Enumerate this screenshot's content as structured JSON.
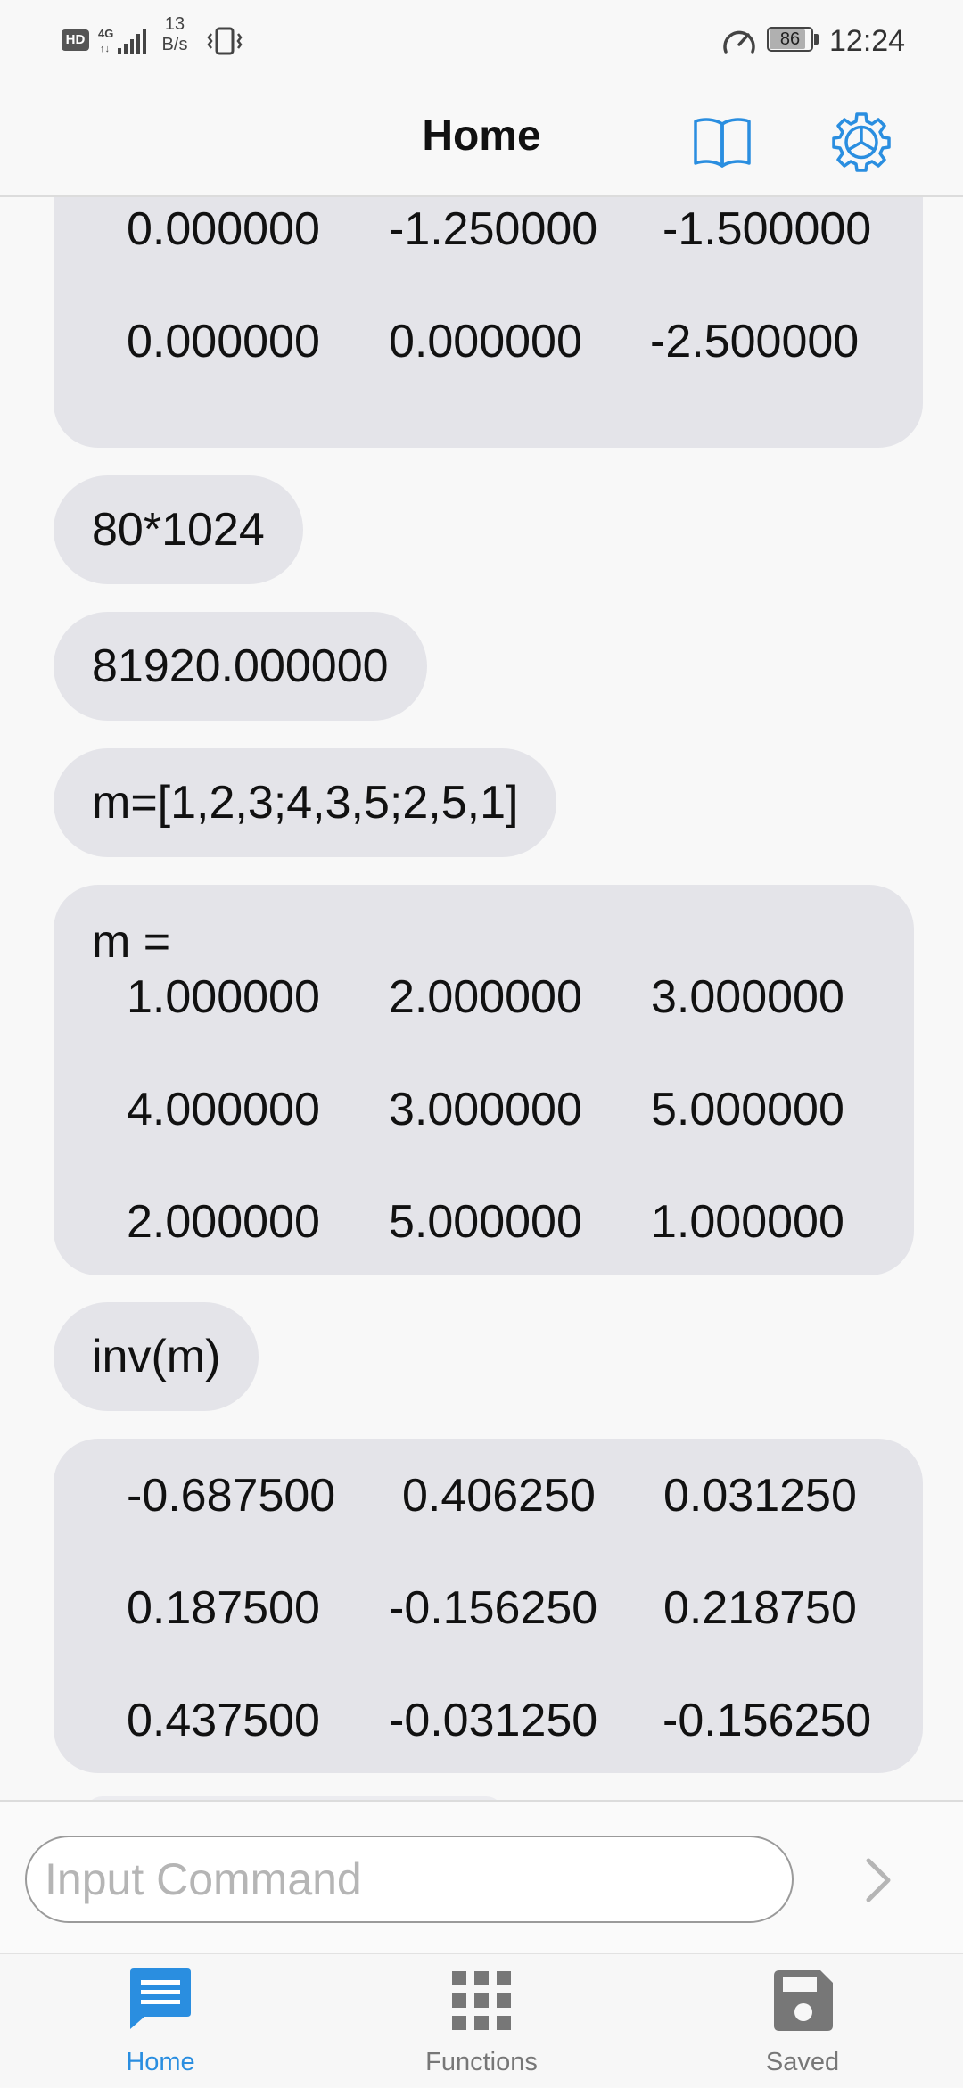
{
  "status_bar": {
    "hd": "HD",
    "network": "4G",
    "speed_value": "13",
    "speed_unit": "B/s",
    "battery": "86",
    "battery_level": 0.86,
    "time": "12:24"
  },
  "header": {
    "title": "Home",
    "icons": [
      "book-icon",
      "gear-icon"
    ]
  },
  "history": {
    "partial_matrix": {
      "rows": [
        [
          "0.000000",
          "-1.250000",
          "-1.500000"
        ],
        [
          "0.000000",
          "0.000000",
          "-2.500000"
        ]
      ]
    },
    "entries": [
      {
        "text": "80*1024"
      },
      {
        "text": "81920.000000"
      },
      {
        "text": "m=[1,2,3;4,3,5;2,5,1]"
      }
    ],
    "matrix_m": {
      "label": "m =",
      "rows": [
        [
          "1.000000",
          "2.000000",
          "3.000000"
        ],
        [
          "4.000000",
          "3.000000",
          "5.000000"
        ],
        [
          "2.000000",
          "5.000000",
          "1.000000"
        ]
      ]
    },
    "inv_command": "inv(m)",
    "inv_result": {
      "rows": [
        [
          "-0.687500",
          "0.406250",
          "0.031250"
        ],
        [
          "0.187500",
          "-0.156250",
          "0.218750"
        ],
        [
          "0.437500",
          "-0.031250",
          "-0.156250"
        ]
      ]
    }
  },
  "input": {
    "value": "",
    "placeholder": "Input Command"
  },
  "nav": {
    "accent_color": "#2a8ee0",
    "inactive_color": "#777777",
    "items": [
      {
        "label": "Home",
        "icon": "chat-icon",
        "active": true
      },
      {
        "label": "Functions",
        "icon": "grid-icon",
        "active": false
      },
      {
        "label": "Saved",
        "icon": "save-icon",
        "active": false
      }
    ]
  }
}
